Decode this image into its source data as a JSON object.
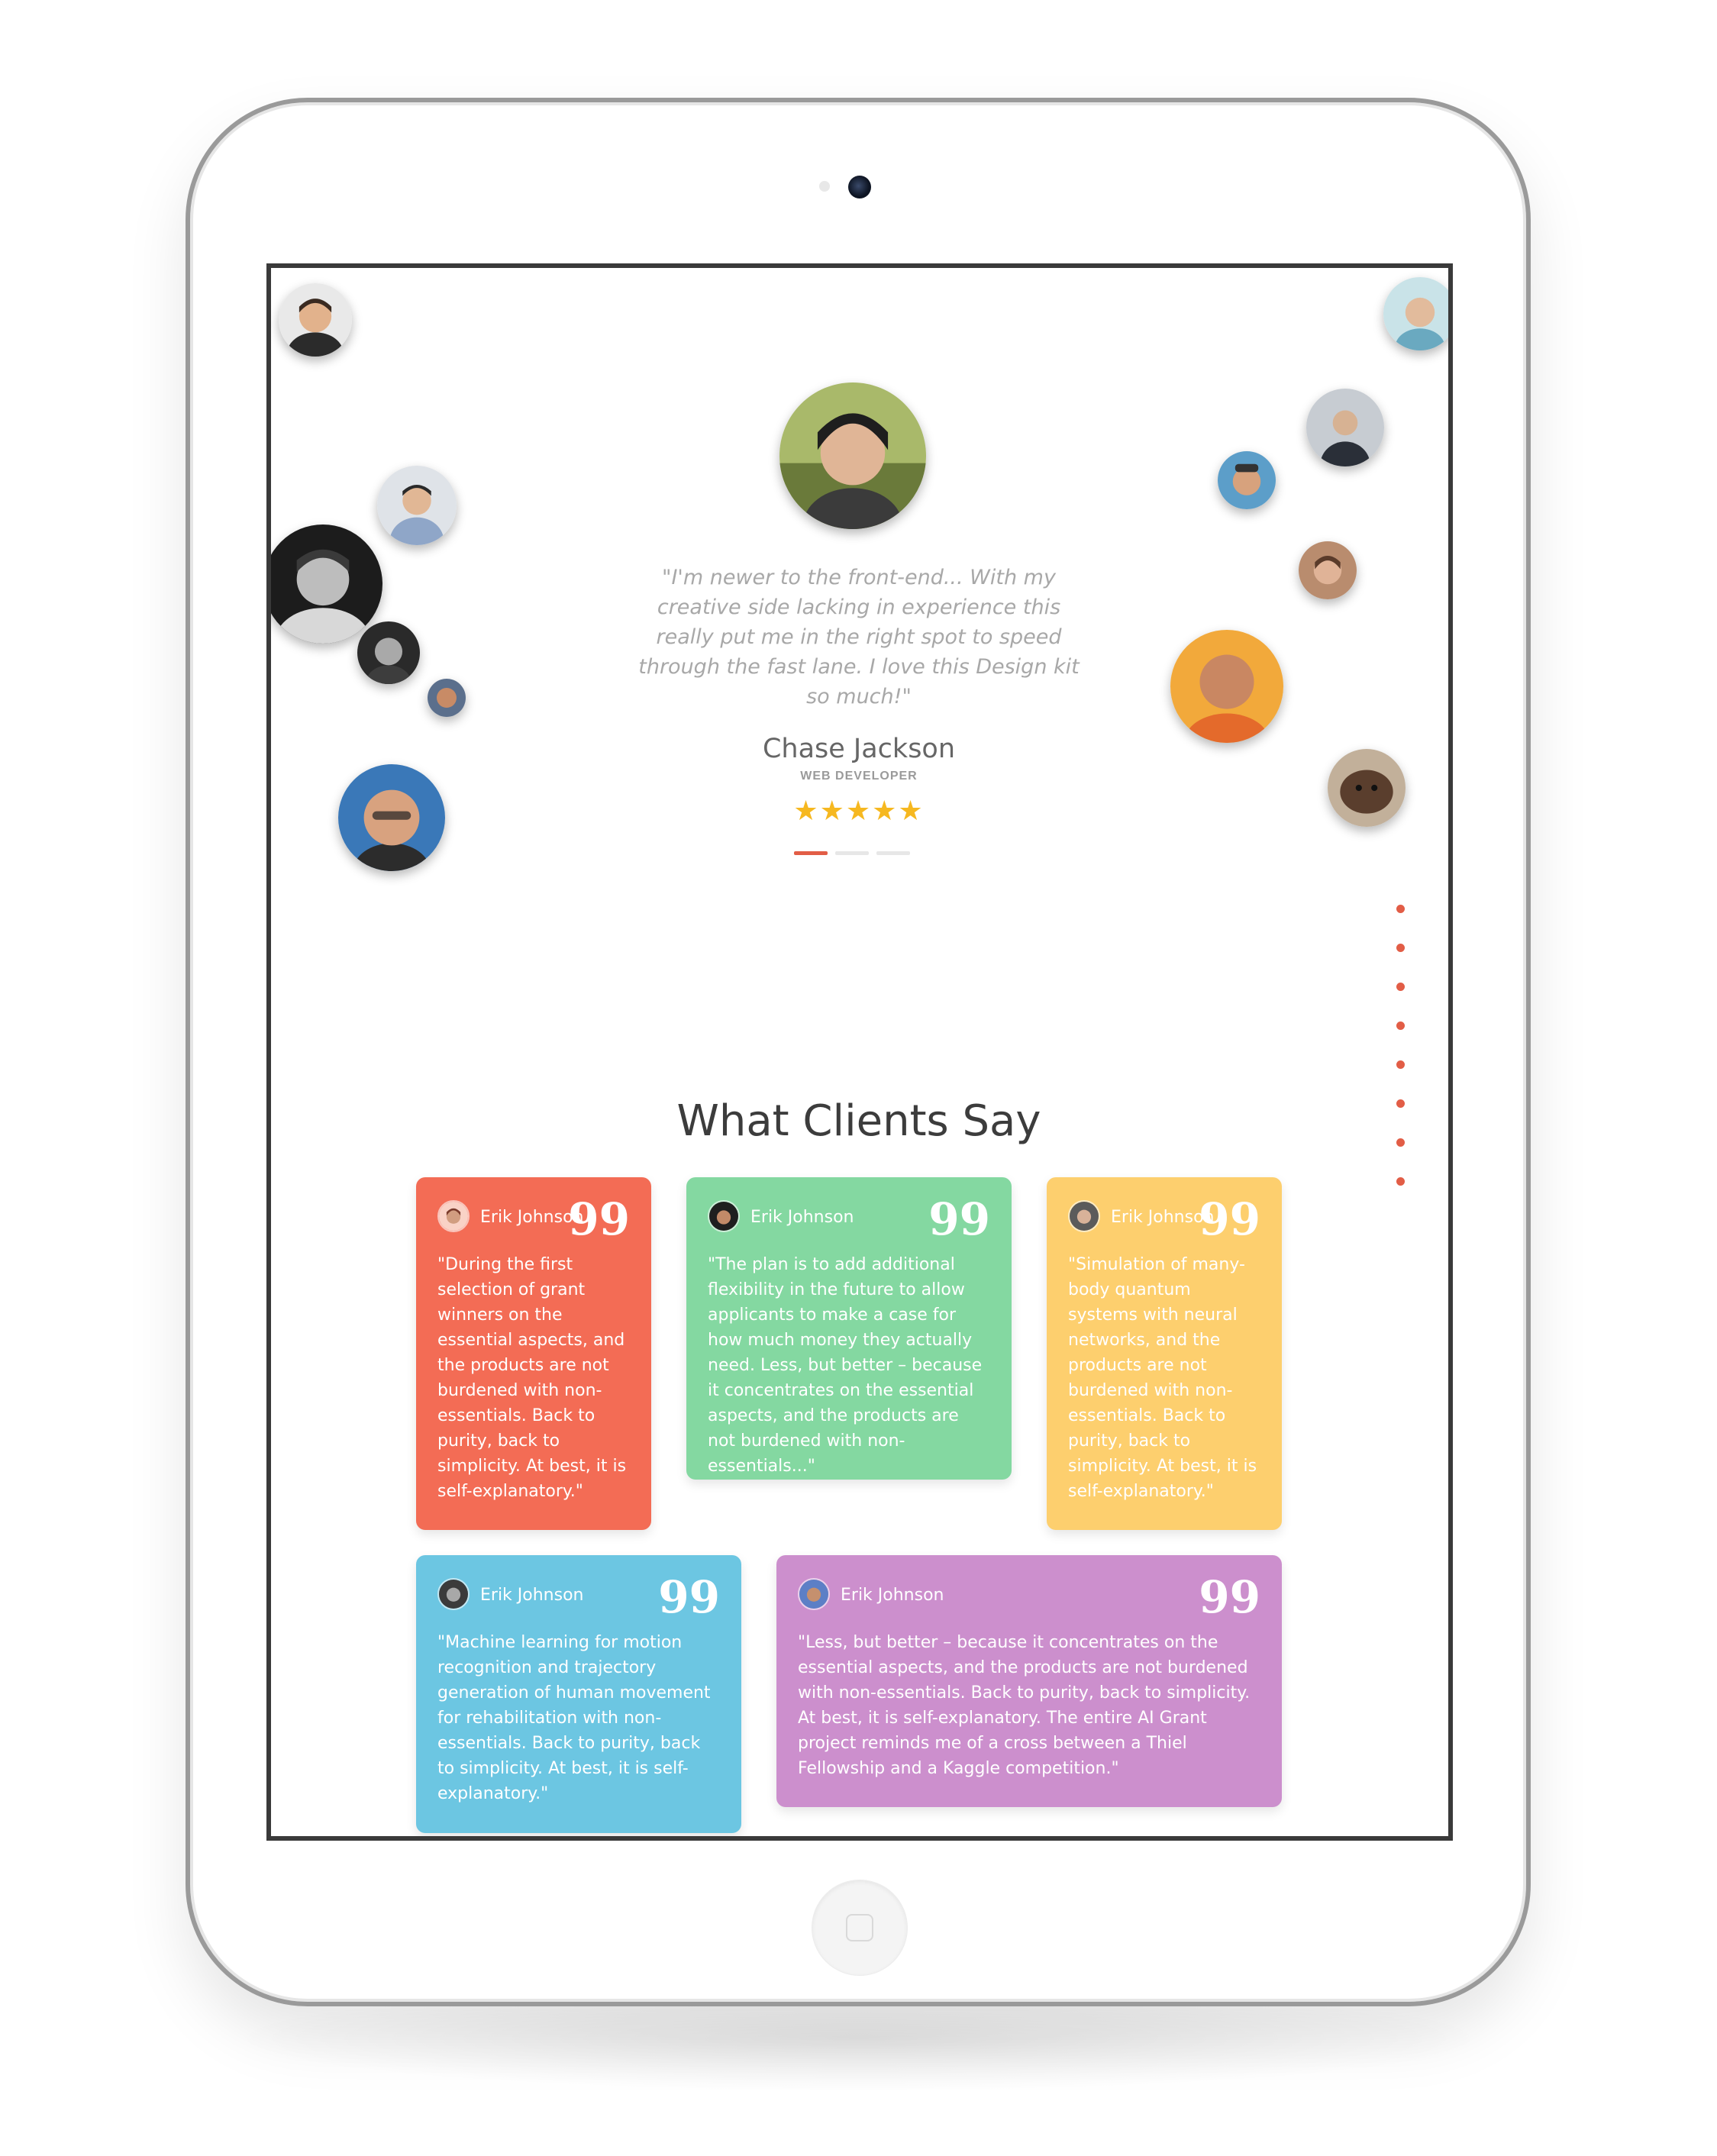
{
  "hero": {
    "quote": "\"I'm newer to the front-end... With my creative side lacking in experience this really put me in the right spot to speed through the fast lane. I love this Design kit so much!\"",
    "name": "Chase Jackson",
    "role": "WEB DEVELOPER",
    "stars": "★★★★★",
    "rating": 5,
    "active_indicator": 0
  },
  "section": {
    "title": "What Clients Say"
  },
  "testimonials": [
    {
      "name": "Erik Johnson",
      "quote_mark": "99",
      "color": "#f36c55",
      "text": "\"During the first selection of grant winners on the essential aspects, and the products are not burdened with non-essentials. Back to purity, back to simplicity. At best, it is self-explanatory.\""
    },
    {
      "name": "Erik Johnson",
      "quote_mark": "99",
      "color": "#84d8a1",
      "text": "\"The plan is to add additional flexibility in the future to allow applicants to make a case for how much money they actually need. Less, but better – because it concentrates on the essential aspects, and the products are not burdened with non-essentials...\""
    },
    {
      "name": "Erik Johnson",
      "quote_mark": "99",
      "color": "#fdcf6e",
      "text": "\"Simulation of many-body quantum systems with neural networks, and the products are not burdened with non-essentials. Back to purity, back to simplicity. At best, it is self-explanatory.\""
    },
    {
      "name": "Erik Johnson",
      "quote_mark": "99",
      "color": "#6cc6e2",
      "text": "\"Machine learning for motion recognition and trajectory generation of human movement for rehabilitation with non-essentials. Back to purity, back to simplicity. At best, it is self-explanatory.\""
    },
    {
      "name": "Erik Johnson",
      "quote_mark": "99",
      "color": "#cc8fcd",
      "text": "\"Less, but better – because it concentrates on the essential aspects, and the products are not burdened with non-essentials. Back to purity, back to simplicity. At best, it is self-explanatory. The entire AI Grant project reminds me of a cross between a Thiel Fellowship and a Kaggle competition.\""
    }
  ],
  "colors": {
    "accent": "#e25d46",
    "star": "#f6b820"
  }
}
